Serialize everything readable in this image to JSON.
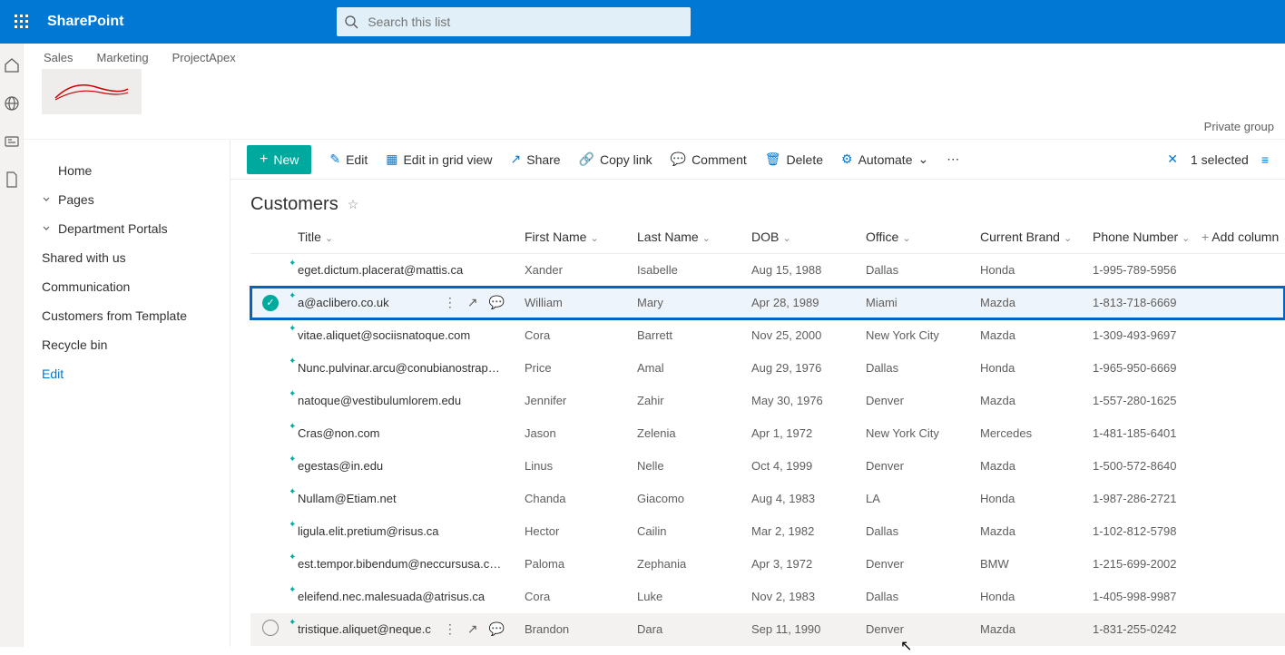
{
  "suite": {
    "brand": "SharePoint",
    "search_placeholder": "Search this list"
  },
  "hub_tabs": [
    "Sales",
    "Marketing",
    "ProjectApex"
  ],
  "hub_meta": "Private group",
  "leftnav": {
    "home": "Home",
    "pages": "Pages",
    "dept": "Department Portals",
    "shared": "Shared with us",
    "comm": "Communication",
    "cft": "Customers from Template",
    "recycle": "Recycle bin",
    "edit": "Edit"
  },
  "cmd": {
    "new": "New",
    "edit": "Edit",
    "grid": "Edit in grid view",
    "share": "Share",
    "copy": "Copy link",
    "comment": "Comment",
    "delete": "Delete",
    "automate": "Automate",
    "selected": "1 selected"
  },
  "list": {
    "title": "Customers"
  },
  "columns": {
    "title": "Title",
    "first": "First Name",
    "last": "Last Name",
    "dob": "DOB",
    "office": "Office",
    "brand": "Current Brand",
    "phone": "Phone Number",
    "add": "Add column"
  },
  "rows": [
    {
      "title": "eget.dictum.placerat@mattis.ca",
      "first": "Xander",
      "last": "Isabelle",
      "dob": "Aug 15, 1988",
      "office": "Dallas",
      "brand": "Honda",
      "phone": "1-995-789-5956",
      "sel": false,
      "hover": false
    },
    {
      "title": "a@aclibero.co.uk",
      "first": "William",
      "last": "Mary",
      "dob": "Apr 28, 1989",
      "office": "Miami",
      "brand": "Mazda",
      "phone": "1-813-718-6669",
      "sel": true,
      "hover": false
    },
    {
      "title": "vitae.aliquet@sociisnatoque.com",
      "first": "Cora",
      "last": "Barrett",
      "dob": "Nov 25, 2000",
      "office": "New York City",
      "brand": "Mazda",
      "phone": "1-309-493-9697",
      "sel": false,
      "hover": false
    },
    {
      "title": "Nunc.pulvinar.arcu@conubianostraper.edu",
      "first": "Price",
      "last": "Amal",
      "dob": "Aug 29, 1976",
      "office": "Dallas",
      "brand": "Honda",
      "phone": "1-965-950-6669",
      "sel": false,
      "hover": false
    },
    {
      "title": "natoque@vestibulumlorem.edu",
      "first": "Jennifer",
      "last": "Zahir",
      "dob": "May 30, 1976",
      "office": "Denver",
      "brand": "Mazda",
      "phone": "1-557-280-1625",
      "sel": false,
      "hover": false
    },
    {
      "title": "Cras@non.com",
      "first": "Jason",
      "last": "Zelenia",
      "dob": "Apr 1, 1972",
      "office": "New York City",
      "brand": "Mercedes",
      "phone": "1-481-185-6401",
      "sel": false,
      "hover": false
    },
    {
      "title": "egestas@in.edu",
      "first": "Linus",
      "last": "Nelle",
      "dob": "Oct 4, 1999",
      "office": "Denver",
      "brand": "Mazda",
      "phone": "1-500-572-8640",
      "sel": false,
      "hover": false
    },
    {
      "title": "Nullam@Etiam.net",
      "first": "Chanda",
      "last": "Giacomo",
      "dob": "Aug 4, 1983",
      "office": "LA",
      "brand": "Honda",
      "phone": "1-987-286-2721",
      "sel": false,
      "hover": false
    },
    {
      "title": "ligula.elit.pretium@risus.ca",
      "first": "Hector",
      "last": "Cailin",
      "dob": "Mar 2, 1982",
      "office": "Dallas",
      "brand": "Mazda",
      "phone": "1-102-812-5798",
      "sel": false,
      "hover": false
    },
    {
      "title": "est.tempor.bibendum@neccursusa.com",
      "first": "Paloma",
      "last": "Zephania",
      "dob": "Apr 3, 1972",
      "office": "Denver",
      "brand": "BMW",
      "phone": "1-215-699-2002",
      "sel": false,
      "hover": false
    },
    {
      "title": "eleifend.nec.malesuada@atrisus.ca",
      "first": "Cora",
      "last": "Luke",
      "dob": "Nov 2, 1983",
      "office": "Dallas",
      "brand": "Honda",
      "phone": "1-405-998-9987",
      "sel": false,
      "hover": false
    },
    {
      "title": "tristique.aliquet@neque.c",
      "first": "Brandon",
      "last": "Dara",
      "dob": "Sep 11, 1990",
      "office": "Denver",
      "brand": "Mazda",
      "phone": "1-831-255-0242",
      "sel": false,
      "hover": true
    }
  ]
}
